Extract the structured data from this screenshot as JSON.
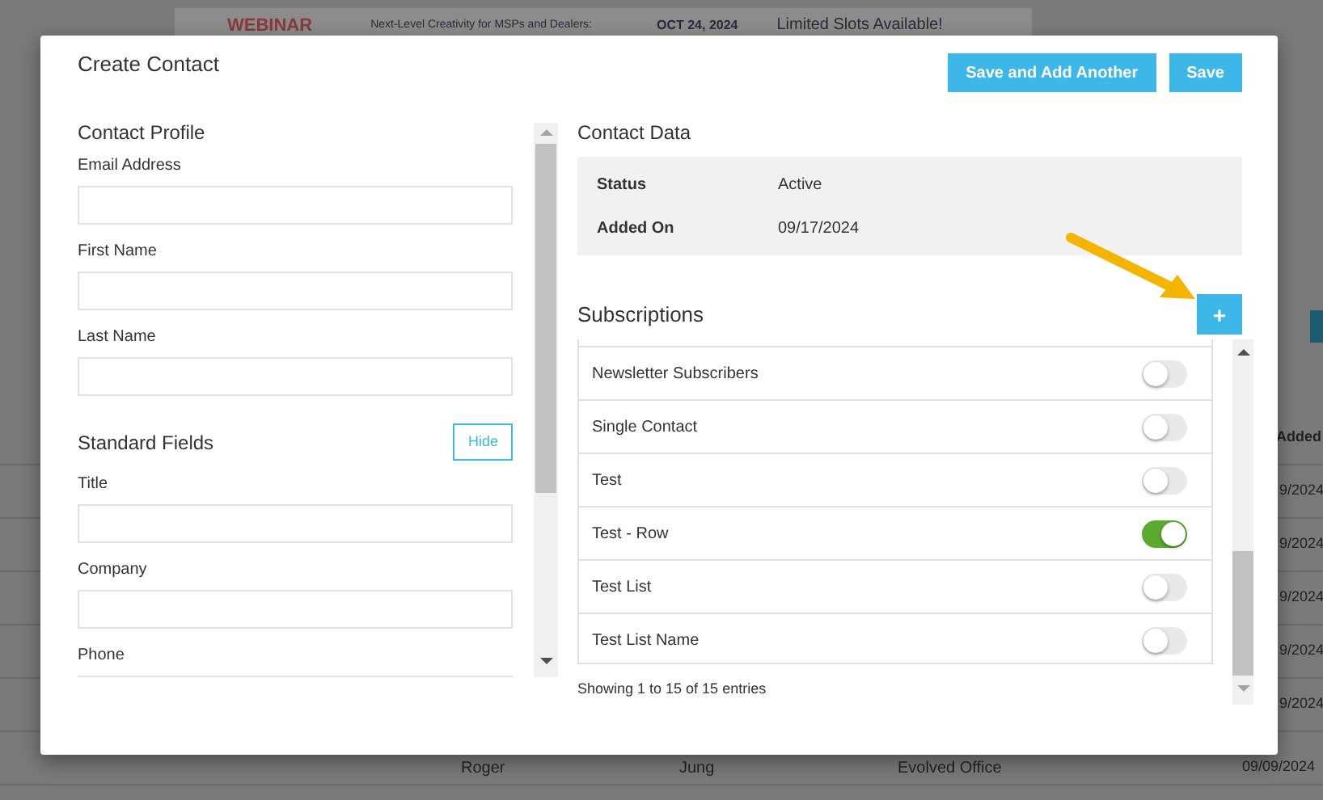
{
  "background_page": {
    "banner": {
      "label": "WEBINAR",
      "headline": "Next-Level Creativity for MSPs and Dealers:",
      "date": "OCT 24, 2024",
      "note": "Limited Slots Available!"
    },
    "table": {
      "column_header": "Added",
      "dates": [
        "9/2024",
        "9/2024",
        "9/2024",
        "9/2024",
        "9/2024"
      ],
      "last_row": {
        "first_name": "Roger",
        "last_name": "Jung",
        "company": "Evolved Office",
        "date": "09/09/2024"
      }
    }
  },
  "dialog": {
    "title": "Create Contact",
    "buttons": [
      "Save and Add Another",
      "Save"
    ],
    "contact_profile": {
      "heading": "Contact Profile",
      "fields": [
        {
          "label": "Email Address"
        },
        {
          "label": "First Name"
        },
        {
          "label": "Last Name"
        }
      ]
    },
    "standard_fields": {
      "heading": "Standard Fields",
      "toggle_button": "Hide",
      "fields": [
        {
          "label": "Title"
        },
        {
          "label": "Company"
        },
        {
          "label": "Phone"
        }
      ]
    },
    "contact_data": {
      "heading": "Contact Data",
      "rows": [
        {
          "label": "Status",
          "value": "Active"
        },
        {
          "label": "Added On",
          "value": "09/17/2024"
        }
      ]
    },
    "subscriptions": {
      "heading": "Subscriptions",
      "add_button": "+",
      "items": [
        {
          "name": "Newsletter Subscribers",
          "on": false
        },
        {
          "name": "Single Contact",
          "on": false
        },
        {
          "name": "Test",
          "on": false
        },
        {
          "name": "Test - Row",
          "on": true
        },
        {
          "name": "Test List",
          "on": false
        },
        {
          "name": "Test List Name",
          "on": false
        }
      ],
      "footer": "Showing 1 to 15 of 15 entries"
    }
  }
}
